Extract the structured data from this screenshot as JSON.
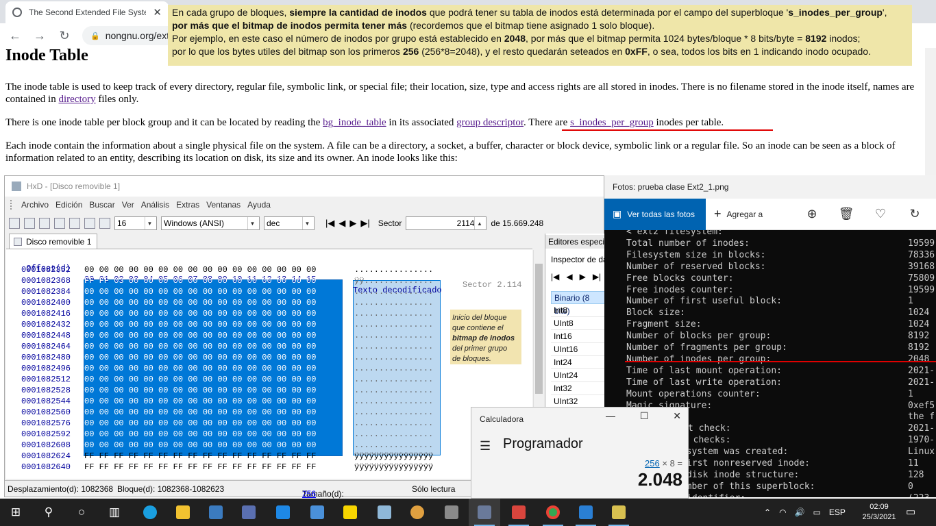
{
  "browser": {
    "tab_title": "The Second Extended File System",
    "tab_close": "✕",
    "url": "nongnu.org/ext2",
    "back": "←",
    "forward": "→",
    "reload": "↻"
  },
  "note": {
    "l1_a": "En cada grupo de bloques, ",
    "l1_b": "siempre la cantidad de inodos",
    "l1_c": " que podrá tener su tabla de inodos está determinada por el campo del superbloque '",
    "l1_d": "s_inodes_per_group",
    "l1_e": "',",
    "l2_a": "por más que el bitmap de inodos permita tener más",
    "l2_b": " (recordemos que el bitmap tiene asignado 1 solo bloque).",
    "l3_a": "Por ejemplo, en este caso el número de inodos por grupo está establecido en ",
    "l3_b": "2048",
    "l3_c": ", por más que el bitmap permita 1024 bytes/bloque * 8 bits/byte = ",
    "l3_d": "8192",
    "l3_e": " inodos;",
    "l4_a": "por lo que los bytes utiles del bitmap son los primeros ",
    "l4_b": "256",
    "l4_c": " (256*8=2048), y el resto quedarán seteados en ",
    "l4_d": "0xFF",
    "l4_e": ", o sea, todos los bits en 1 indicando inodo ocupado."
  },
  "page": {
    "heading": "Inode Table",
    "p1_a": "The inode table is used to keep track of every directory, regular file, symbolic link, or special file; their location, size, type and access rights are all stored in inodes. There is no filename stored in the inode itself, names are contained in ",
    "p1_link": "directory",
    "p1_b": " files only.",
    "p2_a": "There is one inode table per block group and it can be located by reading the ",
    "p2_link1": "bg_inode_table",
    "p2_b": " in its associated ",
    "p2_link2": "group descriptor",
    "p2_c": ". There are ",
    "p2_link3": "s_inodes_per_group",
    "p2_d": " inodes per table.",
    "p3": "Each inode contain the information about a single physical file on the system. A file can be a directory, a socket, a buffer, character or block device, symbolic link or a regular file. So an inode can be seen as a block of information related to an entity, describing its location on disk, its size and its owner. An inode looks like this:"
  },
  "hxd": {
    "title": "HxD - [Disco removible 1]",
    "menu": [
      "Archivo",
      "Edición",
      "Buscar",
      "Ver",
      "Análisis",
      "Extras",
      "Ventanas",
      "Ayuda"
    ],
    "bytes_per_row": "16",
    "charset": "Windows (ANSI)",
    "base": "dec",
    "sector_label": "Sector",
    "sector_value": "2114",
    "sector_total": "de 15.669.248",
    "doc_tab": "Disco removible 1",
    "header": {
      "offset": "Offset(d)",
      "bytes": "00 01 02 03 04 05 06 07 08 09 10 11 12 13 14 15",
      "text": "Texto decodificado"
    },
    "rows": [
      {
        "offset": "0001082352",
        "bytes": "00 00 00 00 00 00 00 00 00 00 00 00 00 00 00 00",
        "text": "................"
      },
      {
        "offset": "0001082368",
        "bytes": "FF FF 03 00 00 00 00 00 00 00 00 00 00 00 00 00",
        "text": "ÿÿ.............."
      },
      {
        "offset": "0001082384",
        "bytes": "00 00 00 00 00 00 00 00 00 00 00 00 00 00 00 00",
        "text": "................"
      },
      {
        "offset": "0001082400",
        "bytes": "00 00 00 00 00 00 00 00 00 00 00 00 00 00 00 00",
        "text": "................"
      },
      {
        "offset": "0001082416",
        "bytes": "00 00 00 00 00 00 00 00 00 00 00 00 00 00 00 00",
        "text": "................"
      },
      {
        "offset": "0001082432",
        "bytes": "00 00 00 00 00 00 00 00 00 00 00 00 00 00 00 00",
        "text": "................"
      },
      {
        "offset": "0001082448",
        "bytes": "00 00 00 00 00 00 00 00 00 00 00 00 00 00 00 00",
        "text": "................"
      },
      {
        "offset": "0001082464",
        "bytes": "00 00 00 00 00 00 00 00 00 00 00 00 00 00 00 00",
        "text": "................"
      },
      {
        "offset": "0001082480",
        "bytes": "00 00 00 00 00 00 00 00 00 00 00 00 00 00 00 00",
        "text": "................"
      },
      {
        "offset": "0001082496",
        "bytes": "00 00 00 00 00 00 00 00 00 00 00 00 00 00 00 00",
        "text": "................"
      },
      {
        "offset": "0001082512",
        "bytes": "00 00 00 00 00 00 00 00 00 00 00 00 00 00 00 00",
        "text": "................"
      },
      {
        "offset": "0001082528",
        "bytes": "00 00 00 00 00 00 00 00 00 00 00 00 00 00 00 00",
        "text": "................"
      },
      {
        "offset": "0001082544",
        "bytes": "00 00 00 00 00 00 00 00 00 00 00 00 00 00 00 00",
        "text": "................"
      },
      {
        "offset": "0001082560",
        "bytes": "00 00 00 00 00 00 00 00 00 00 00 00 00 00 00 00",
        "text": "................"
      },
      {
        "offset": "0001082576",
        "bytes": "00 00 00 00 00 00 00 00 00 00 00 00 00 00 00 00",
        "text": "................"
      },
      {
        "offset": "0001082592",
        "bytes": "00 00 00 00 00 00 00 00 00 00 00 00 00 00 00 00",
        "text": "................"
      },
      {
        "offset": "0001082608",
        "bytes": "00 00 00 00 00 00 00 00 00 00 00 00 00 00 00 00",
        "text": "................"
      },
      {
        "offset": "0001082624",
        "bytes": "FF FF FF FF FF FF FF FF FF FF FF FF FF FF FF FF",
        "text": "ÿÿÿÿÿÿÿÿÿÿÿÿÿÿÿÿ"
      },
      {
        "offset": "0001082640",
        "bytes": "FF FF FF FF FF FF FF FF FF FF FF FF FF FF FF FF",
        "text": "ÿÿÿÿÿÿÿÿÿÿÿÿÿÿÿÿ"
      }
    ],
    "sector_marker": "Sector 2.114",
    "annotation": [
      "Inicio del bloque",
      "que contiene el",
      "bitmap de inodos",
      "del primer grupo",
      "de bloques."
    ],
    "inspector_title": "Editores especiales",
    "inspector_sub": "Inspector de datos",
    "inspector_nav": [
      "|◀",
      "◀",
      "▶",
      "▶|"
    ],
    "inspector_types": [
      "Binario (8 bits)",
      "Int8",
      "UInt8",
      "Int16",
      "UInt16",
      "Int24",
      "UInt24",
      "Int32",
      "UInt32"
    ],
    "status": {
      "offset": "Desplazamiento(d): 1082368",
      "block": "Bloque(d): 1082368-1082623",
      "size_label": "Tamaño(d): ",
      "size_value": "256",
      "mode": "Sólo lectura"
    }
  },
  "photos": {
    "title": "Fotos: prueba clase Ext2_1.png",
    "see_all": "Ver todas las fotos",
    "add_to": "Agregar a",
    "terminal": [
      {
        "k": "< ext2 filesystem:",
        "v": ""
      },
      {
        "k": "Total number of inodes:",
        "v": "19599"
      },
      {
        "k": "Filesystem size in blocks:",
        "v": "78336"
      },
      {
        "k": "Number of reserved blocks:",
        "v": "39168"
      },
      {
        "k": "Free blocks counter:",
        "v": "75809"
      },
      {
        "k": "Free inodes counter:",
        "v": "19599"
      },
      {
        "k": "Number of first useful block:",
        "v": "1"
      },
      {
        "k": "Block size:",
        "v": "1024"
      },
      {
        "k": "Fragment size:",
        "v": "1024"
      },
      {
        "k": "Number of blocks per group:",
        "v": "8192"
      },
      {
        "k": "Number of fragments per group:",
        "v": "8192"
      },
      {
        "k": "Number of inodes per group:",
        "v": "2048"
      },
      {
        "k": "Time of last mount operation:",
        "v": "2021-"
      },
      {
        "k": "Time of last write operation:",
        "v": "2021-"
      },
      {
        "k": "Mount operations counter:",
        "v": "1"
      },
      {
        "k": "Magic signature:",
        "v": "0xef5"
      },
      {
        "k": "",
        "v": "the f"
      },
      {
        "k": "",
        "v": "2021-"
      },
      {
        "k": "",
        "v": "1970-"
      },
      {
        "k": "lesystem was created:",
        "v": "Linux"
      },
      {
        "k": "irst nonreserved inode:",
        "v": "11"
      },
      {
        "k": "disk inode structure:",
        "v": "128"
      },
      {
        "k": "number of this superblock:",
        "v": "0"
      },
      {
        "k": "identifier:",
        "v": "(223-"
      }
    ],
    "term_partial": [
      {
        "k": "t check:"
      },
      {
        "k": "n checks:"
      }
    ]
  },
  "calc": {
    "title": "Calculadora",
    "mode": "Programador",
    "expr_a": "256",
    "expr_b": " × 8 =",
    "result": "2.048"
  },
  "taskbar": {
    "lang": "ESP",
    "time": "02:09",
    "date": "25/3/2021"
  }
}
